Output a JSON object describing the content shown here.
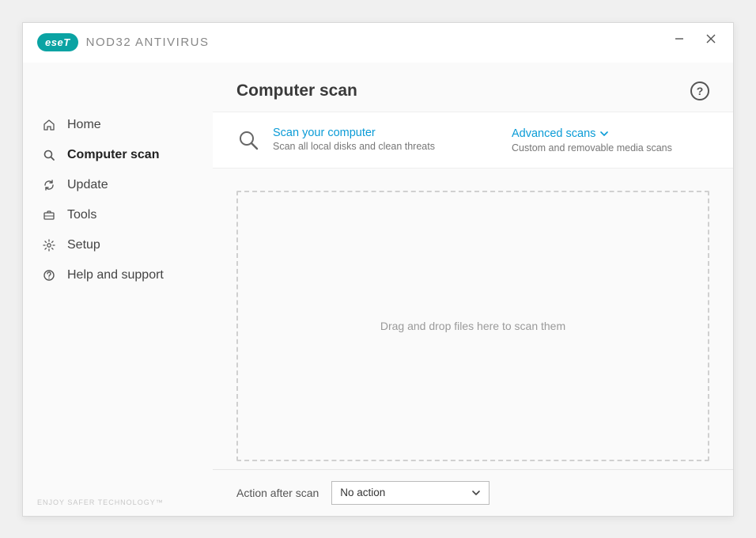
{
  "brand": {
    "badge": "eseT",
    "product": "NOD32 ANTIVIRUS"
  },
  "sidebar": {
    "items": [
      {
        "label": "Home"
      },
      {
        "label": "Computer scan"
      },
      {
        "label": "Update"
      },
      {
        "label": "Tools"
      },
      {
        "label": "Setup"
      },
      {
        "label": "Help and support"
      }
    ],
    "footer": "ENJOY SAFER TECHNOLOGY™"
  },
  "page": {
    "title": "Computer scan",
    "help": "?"
  },
  "scan": {
    "primary": {
      "title": "Scan your computer",
      "sub": "Scan all local disks and clean threats"
    },
    "advanced": {
      "title": "Advanced scans",
      "sub": "Custom and removable media scans"
    }
  },
  "drop": {
    "hint": "Drag and drop files here to scan them"
  },
  "bottom": {
    "label": "Action after scan",
    "selected": "No action"
  }
}
